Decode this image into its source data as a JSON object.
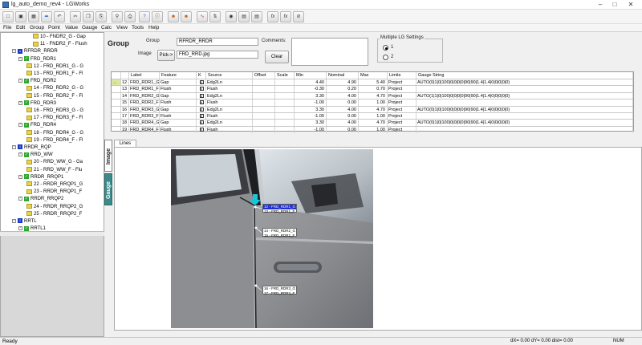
{
  "window": {
    "title": "lg_auto_demo_rev4 - LGWorks"
  },
  "menu": [
    "File",
    "Edit",
    "Group",
    "Point",
    "Value",
    "Gauge",
    "Calc",
    "View",
    "Tools",
    "Help"
  ],
  "tree": {
    "items": [
      {
        "label": "10 - FNDR2_G - Gap",
        "depth": 3,
        "icon": "yellow"
      },
      {
        "label": "11 - FNDR2_F - Flush",
        "depth": 3,
        "icon": "yellow"
      },
      {
        "label": "RFRDR_RRDR",
        "depth": 0,
        "icon": "blue",
        "pm": "-"
      },
      {
        "label": "FRD_RDR1",
        "depth": 1,
        "icon": "green",
        "pm": "-"
      },
      {
        "label": "12 - FRD_RDR1_G - G",
        "depth": 2,
        "icon": "yellow"
      },
      {
        "label": "13 - FRD_RDR1_F - Fl",
        "depth": 2,
        "icon": "yellow"
      },
      {
        "label": "FRD_RDR2",
        "depth": 1,
        "icon": "green",
        "pm": "-"
      },
      {
        "label": "14 - FRD_RDR2_G - G",
        "depth": 2,
        "icon": "yellow"
      },
      {
        "label": "15 - FRD_RDR2_F - Fl",
        "depth": 2,
        "icon": "yellow"
      },
      {
        "label": "FRD_RDR3",
        "depth": 1,
        "icon": "green",
        "pm": "-"
      },
      {
        "label": "16 - FRD_RDR3_G - G",
        "depth": 2,
        "icon": "yellow"
      },
      {
        "label": "17 - FRD_RDR3_F - Fl",
        "depth": 2,
        "icon": "yellow"
      },
      {
        "label": "FRD_RDR4",
        "depth": 1,
        "icon": "green",
        "pm": "-"
      },
      {
        "label": "18 - FRD_RDR4_G - G",
        "depth": 2,
        "icon": "yellow"
      },
      {
        "label": "19 - FRD_RDR4_F - Fl",
        "depth": 2,
        "icon": "yellow"
      },
      {
        "label": "RRDR_RQP",
        "depth": 0,
        "icon": "blue",
        "pm": "-"
      },
      {
        "label": "RRD_WW",
        "depth": 1,
        "icon": "green",
        "pm": "-"
      },
      {
        "label": "20 - RRD_WW_G - Ga",
        "depth": 2,
        "icon": "yellow"
      },
      {
        "label": "21 - RRD_WW_F - Flu",
        "depth": 2,
        "icon": "yellow"
      },
      {
        "label": "RRDR_RRQP1",
        "depth": 1,
        "icon": "green",
        "pm": "-"
      },
      {
        "label": "22 - RRDR_RRQP1_G",
        "depth": 2,
        "icon": "yellow"
      },
      {
        "label": "23 - RRDR_RRQP1_F",
        "depth": 2,
        "icon": "yellow"
      },
      {
        "label": "RRDR_RRQP2",
        "depth": 1,
        "icon": "green",
        "pm": "-"
      },
      {
        "label": "24 - RRDR_RRQP2_G",
        "depth": 2,
        "icon": "yellow"
      },
      {
        "label": "25 - RRDR_RRQP2_F",
        "depth": 2,
        "icon": "yellow"
      },
      {
        "label": "RRTL",
        "depth": 0,
        "icon": "blue",
        "pm": "-"
      },
      {
        "label": "RRTL1",
        "depth": 1,
        "icon": "green",
        "pm": "-"
      }
    ]
  },
  "group_panel": {
    "heading": "Group",
    "group_label": "Group",
    "group_value": "RFRDR_RRDR",
    "image_label": "Image",
    "pick_button": "Pick->",
    "image_value": "FRD_RRD.jpg",
    "comments_label": "Comments:",
    "clear_button": "Clear",
    "multiple_lg_label": "Multiple LG Settings",
    "radio_options": [
      "1",
      "2"
    ],
    "radio_selected": "1"
  },
  "grid": {
    "columns": [
      "Label",
      "Feature",
      "K",
      "Source",
      "Offset",
      "Scale",
      "Min",
      "Nominal",
      "Max",
      "Limits",
      "Gauge String"
    ],
    "rows": [
      {
        "num": "12",
        "label": "FRD_RDR1_G",
        "feature": "Gap",
        "k": "X",
        "source": "Edg2Ln",
        "offset": "",
        "scale": "",
        "min": "4.40",
        "nominal": "4.90",
        "max": "5.40",
        "limits": "Project",
        "gauge": "AUTO(0|1|0|100|0|0|0|0|90|90|1.4|1.4|0|0|0|0|0)",
        "current": true
      },
      {
        "num": "13",
        "label": "FRD_RDR1_F",
        "feature": "Flush",
        "k": "X",
        "source": "Flush",
        "offset": "",
        "scale": "",
        "min": "-0.30",
        "nominal": "0.20",
        "max": "0.70",
        "limits": "Project",
        "gauge": ""
      },
      {
        "num": "14",
        "label": "FRD_RDR2_G",
        "feature": "Gap",
        "k": "X",
        "source": "Edg2Ln",
        "offset": "",
        "scale": "",
        "min": "3.30",
        "nominal": "4.00",
        "max": "4.70",
        "limits": "Project",
        "gauge": "AUTO(1|1|0|100|0|0|0|0|90|90|1.4|1.4|0|0|0|0|0)"
      },
      {
        "num": "15",
        "label": "FRD_RDR2_F",
        "feature": "Flush",
        "k": "X",
        "source": "Flush",
        "offset": "",
        "scale": "",
        "min": "-1.00",
        "nominal": "0.00",
        "max": "1.00",
        "limits": "Project",
        "gauge": ""
      },
      {
        "num": "16",
        "label": "FRD_RDR3_G",
        "feature": "Gap",
        "k": "X",
        "source": "Edg2Ln",
        "offset": "",
        "scale": "",
        "min": "3.30",
        "nominal": "4.00",
        "max": "4.70",
        "limits": "Project",
        "gauge": "AUTO(0|1|0|100|0|0|0|0|90|90|1.4|1.4|0|0|0|0|0)"
      },
      {
        "num": "17",
        "label": "FRD_RDR3_F",
        "feature": "Flush",
        "k": "X",
        "source": "Flush",
        "offset": "",
        "scale": "",
        "min": "-1.00",
        "nominal": "0.00",
        "max": "1.00",
        "limits": "Project",
        "gauge": ""
      },
      {
        "num": "18",
        "label": "FRD_RDR4_G",
        "feature": "Gap",
        "k": "X",
        "source": "Edg2Ln",
        "offset": "",
        "scale": "",
        "min": "3.30",
        "nominal": "4.00",
        "max": "4.70",
        "limits": "Project",
        "gauge": "AUTO(0|1|0|100|0|0|0|0|90|90|1.4|1.4|0|0|0|0|0)"
      },
      {
        "num": "19",
        "label": "FRD_RDR4_F",
        "feature": "Flush",
        "k": "X",
        "source": "Flush",
        "offset": "",
        "scale": "",
        "min": "-1.00",
        "nominal": "0.00",
        "max": "1.00",
        "limits": "Project",
        "gauge": ""
      }
    ]
  },
  "tabs": {
    "image": "Image",
    "gauge": "Gauge",
    "lines": "Lines"
  },
  "callouts": [
    {
      "lines": [
        "12 - FRD_RDR1_G",
        "13 - FRD_RDR1_F"
      ],
      "selected": true
    },
    {
      "lines": [
        "14 - FRD_RDR2_G",
        "15 - FRD_RDR2_F"
      ],
      "selected": false
    },
    {
      "lines": [
        "16 - FRD_RDR3_G",
        "17 - FRD_RDR3_F"
      ],
      "selected": false
    }
  ],
  "status": {
    "left": "Ready",
    "coords": "dX= 0.00  dY= 0.00  dist= 0.00",
    "num": "NUM"
  },
  "colors": {
    "gauge_tab": "#3d8a8a",
    "selected_callout": "#1f2fd0",
    "arrow": "#16c7d8"
  }
}
